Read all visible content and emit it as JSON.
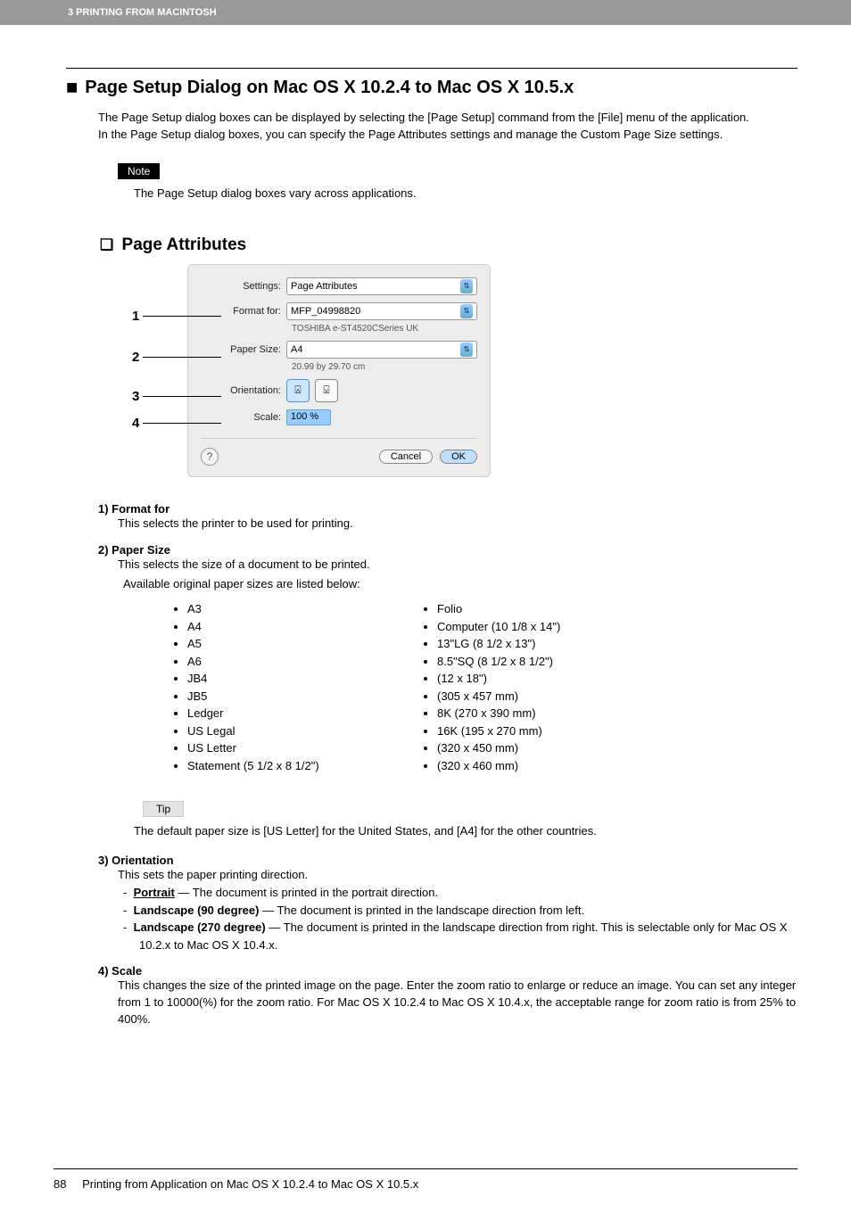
{
  "header": {
    "chapter": "3 PRINTING FROM MACINTOSH"
  },
  "heading": "Page Setup Dialog on Mac OS X 10.2.4 to Mac OS X 10.5.x",
  "intro1": "The Page Setup dialog boxes can be displayed by selecting the [Page Setup] command from the [File] menu of the application.",
  "intro2": "In the Page Setup dialog boxes, you can specify the Page Attributes settings and manage the Custom Page Size settings.",
  "note_label": "Note",
  "note_text": "The Page Setup dialog boxes vary across applications.",
  "sub_heading": "Page Attributes",
  "dialog": {
    "settings_label": "Settings:",
    "settings_value": "Page Attributes",
    "format_label": "Format for:",
    "format_value": "MFP_04998820",
    "format_sub": "TOSHIBA e-ST4520CSeries UK",
    "paper_label": "Paper Size:",
    "paper_value": "A4",
    "paper_sub": "20.99 by 29.70 cm",
    "orient_label": "Orientation:",
    "scale_label": "Scale:",
    "scale_value": "100 %",
    "cancel": "Cancel",
    "ok": "OK"
  },
  "callouts": {
    "c1": "1",
    "c2": "2",
    "c3": "3",
    "c4": "4"
  },
  "desc": {
    "d1_head": "1)  Format for",
    "d1_body": "This selects the printer to be used for printing.",
    "d2_head": "2)  Paper Size",
    "d2_body": "This selects the size of a document to be printed.",
    "d2_sub": "Available original paper sizes are listed below:",
    "sizes_left": [
      "A3",
      "A4",
      "A5",
      "A6",
      "JB4",
      "JB5",
      "Ledger",
      "US Legal",
      "US Letter",
      "Statement (5 1/2 x 8 1/2\")"
    ],
    "sizes_right": [
      "Folio",
      "Computer (10 1/8 x 14\")",
      "13\"LG (8 1/2 x 13\")",
      "8.5\"SQ (8 1/2 x 8 1/2\")",
      "(12 x 18\")",
      "(305 x 457 mm)",
      "8K (270 x 390 mm)",
      "16K (195 x 270 mm)",
      "(320 x 450 mm)",
      "(320 x 460 mm)"
    ]
  },
  "tip_label": "Tip",
  "tip_text": "The default paper size is [US Letter] for the United States, and [A4] for the other countries.",
  "d3_head": "3)  Orientation",
  "d3_body": "This sets the paper printing direction.",
  "d3_o1_b": "Portrait",
  "d3_o1_t": " — The document is printed in the portrait direction.",
  "d3_o2_b": "Landscape (90 degree)",
  "d3_o2_t": " — The document is printed in the landscape direction from left.",
  "d3_o3_b": "Landscape (270 degree)",
  "d3_o3_t": " — The document is printed in the landscape direction from right.  This is selectable only for Mac OS X 10.2.x to Mac OS X 10.4.x.",
  "d4_head": "4)  Scale",
  "d4_body": "This changes the size of the printed image on the page.  Enter the zoom ratio to enlarge or reduce an image. You can set any integer from 1 to 10000(%) for the zoom ratio.  For Mac OS X 10.2.4 to Mac OS X 10.4.x, the acceptable range for zoom ratio is from 25% to 400%.",
  "footer": {
    "page": "88",
    "text": "Printing from Application on Mac OS X 10.2.4 to Mac OS X 10.5.x"
  }
}
